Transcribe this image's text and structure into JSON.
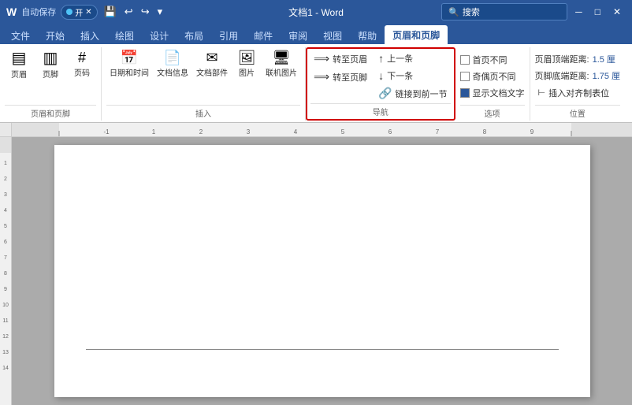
{
  "titleBar": {
    "autosave_label": "自动保存",
    "toggle_state": "开",
    "title": "文档1 - Word",
    "search_placeholder": "搜索",
    "quick_buttons": [
      "💾",
      "↩",
      "↪",
      "▾"
    ]
  },
  "ribbonTabs": {
    "tabs": [
      "文件",
      "开始",
      "插入",
      "绘图",
      "设计",
      "布局",
      "引用",
      "邮件",
      "审阅",
      "视图",
      "帮助",
      "页眉和页脚"
    ],
    "active": "页眉和页脚"
  },
  "groups": {
    "header_footer": {
      "label": "页眉和页脚",
      "items": [
        {
          "icon": "▤",
          "label": "页眉"
        },
        {
          "icon": "▥",
          "label": "页脚"
        },
        {
          "icon": "#",
          "label": "页码"
        }
      ]
    },
    "insert": {
      "label": "插入",
      "items": [
        {
          "icon": "📅",
          "label": "日期和时间"
        },
        {
          "icon": "📄",
          "label": "文档信息"
        },
        {
          "icon": "✉",
          "label": "文档部件"
        },
        {
          "icon": "🖼",
          "label": "图片"
        },
        {
          "icon": "🖥",
          "label": "联机图片"
        }
      ]
    },
    "navigation": {
      "label": "导航",
      "items_left": [
        {
          "icon": "⟹",
          "label": "转至页眉"
        },
        {
          "icon": "⟹",
          "label": "转至页脚"
        }
      ],
      "items_right": [
        {
          "label": "上一条"
        },
        {
          "label": "下一条"
        },
        {
          "label": "链接到前一节"
        }
      ]
    },
    "options": {
      "label": "选项",
      "items": [
        {
          "label": "首页不同",
          "checked": false
        },
        {
          "label": "奇偶页不同",
          "checked": false
        },
        {
          "label": "显示文档文字",
          "checked": true
        }
      ]
    },
    "position": {
      "label": "位置",
      "items": [
        {
          "label": "页眉顶端距离:",
          "value": "1.5 厘"
        },
        {
          "label": "页脚底端距离:",
          "value": "1.75 厘"
        },
        {
          "label": "插入对齐制表位"
        }
      ]
    }
  },
  "document": {
    "title": "文档1"
  }
}
